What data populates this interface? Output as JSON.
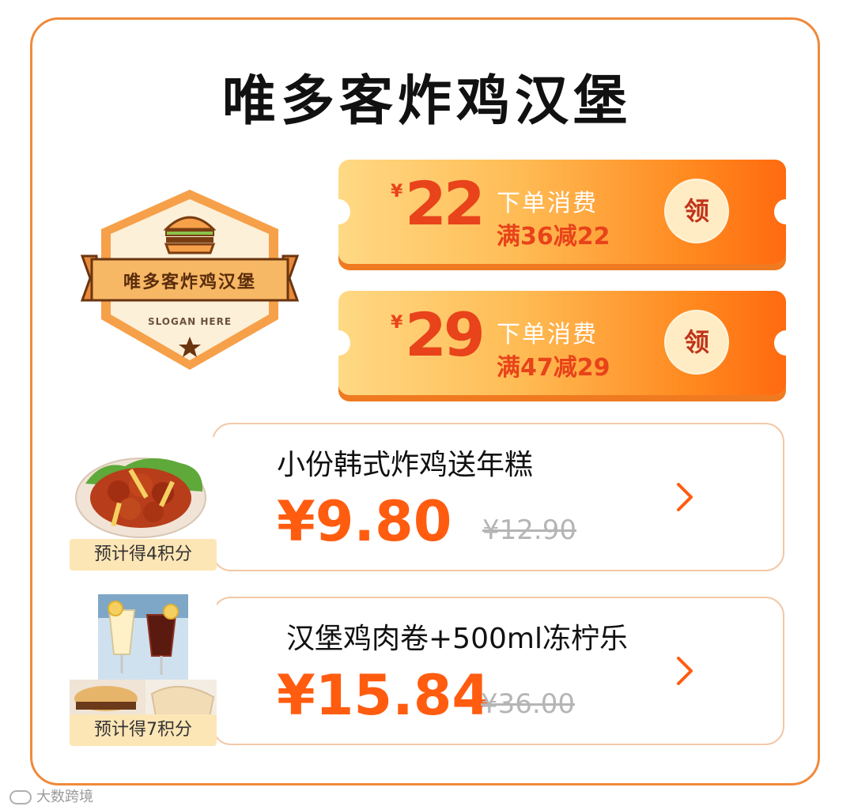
{
  "shop": {
    "title": "唯多客炸鸡汉堡"
  },
  "logo": {
    "name": "唯多客炸鸡汉堡",
    "slogan": "SLOGAN HERE"
  },
  "coupons": [
    {
      "currency": "¥",
      "amount": "22",
      "line1": "下单消费",
      "line2": "满36减22",
      "claim_label": "领"
    },
    {
      "currency": "¥",
      "amount": "29",
      "line1": "下单消费",
      "line2": "满47减29",
      "claim_label": "领"
    }
  ],
  "products": [
    {
      "title": "小份韩式炸鸡送年糕",
      "price": "¥9.80",
      "original_price": "¥12.90",
      "points": "预计得4积分"
    },
    {
      "title": "汉堡鸡肉卷+500ml冻柠乐",
      "price": "¥15.84",
      "original_price": "¥36.00",
      "points": "预计得7积分"
    }
  ],
  "watermark": {
    "text": "大数跨境"
  },
  "colors": {
    "accent": "#ff5c10",
    "border": "#ef8a3c",
    "coupon_start": "#ffd985",
    "coupon_end": "#ff6a10"
  }
}
